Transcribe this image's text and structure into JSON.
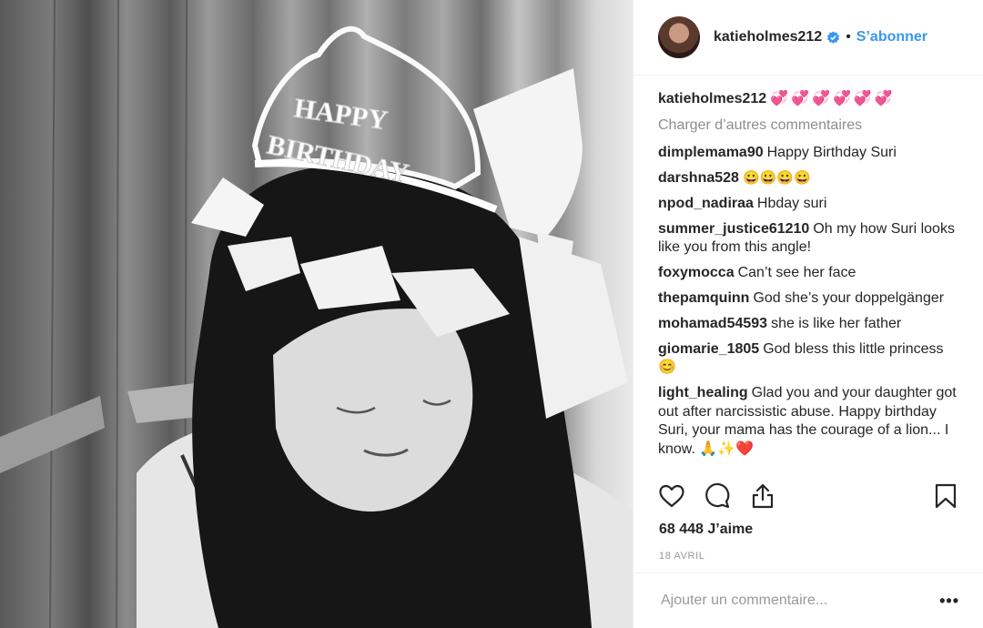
{
  "header": {
    "username": "katieholmes212",
    "separator": "•",
    "follow_label": "S’abonner"
  },
  "photo": {
    "tiara_text_1": "HAPPY",
    "tiara_text_2": "BIRTHDAY"
  },
  "caption": {
    "username": "katieholmes212",
    "text": "💞💞💞💞💞💞"
  },
  "load_more_label": "Charger d’autres commentaires",
  "comments": [
    {
      "user": "dimplemama90",
      "text": "Happy Birthday Suri"
    },
    {
      "user": "darshna528",
      "text": "😀😀😀😀"
    },
    {
      "user": "npod_nadiraa",
      "text": "Hbday suri"
    },
    {
      "user": "summer_justice61210",
      "text": "Oh my how Suri looks like you from this angle!"
    },
    {
      "user": "foxymocca",
      "text": "Can’t see her face"
    },
    {
      "user": "thepamquinn",
      "text": "God she’s your doppelgänger"
    },
    {
      "user": "mohamad54593",
      "text": "she is like her father"
    },
    {
      "user": "giomarie_1805",
      "text": "God bless this little princess 😊"
    },
    {
      "user": "light_healing",
      "text": "Glad you and your daughter got out after narcissistic abuse. Happy birthday Suri, your mama has the courage of a lion... I know. 🙏✨❤️"
    }
  ],
  "likes": "68 448 J’aime",
  "date": "18 avril",
  "add_comment": {
    "placeholder": "Ajouter un commentaire...",
    "more_label": "•••"
  },
  "icons": {
    "verified": "verified-badge-icon",
    "like": "heart-icon",
    "comment": "comment-bubble-icon",
    "share": "share-icon",
    "save": "bookmark-icon",
    "more": "more-options-icon"
  },
  "colors": {
    "link": "#3897f0",
    "muted": "#8e8e8e",
    "text": "#262626",
    "border": "#efefef"
  }
}
